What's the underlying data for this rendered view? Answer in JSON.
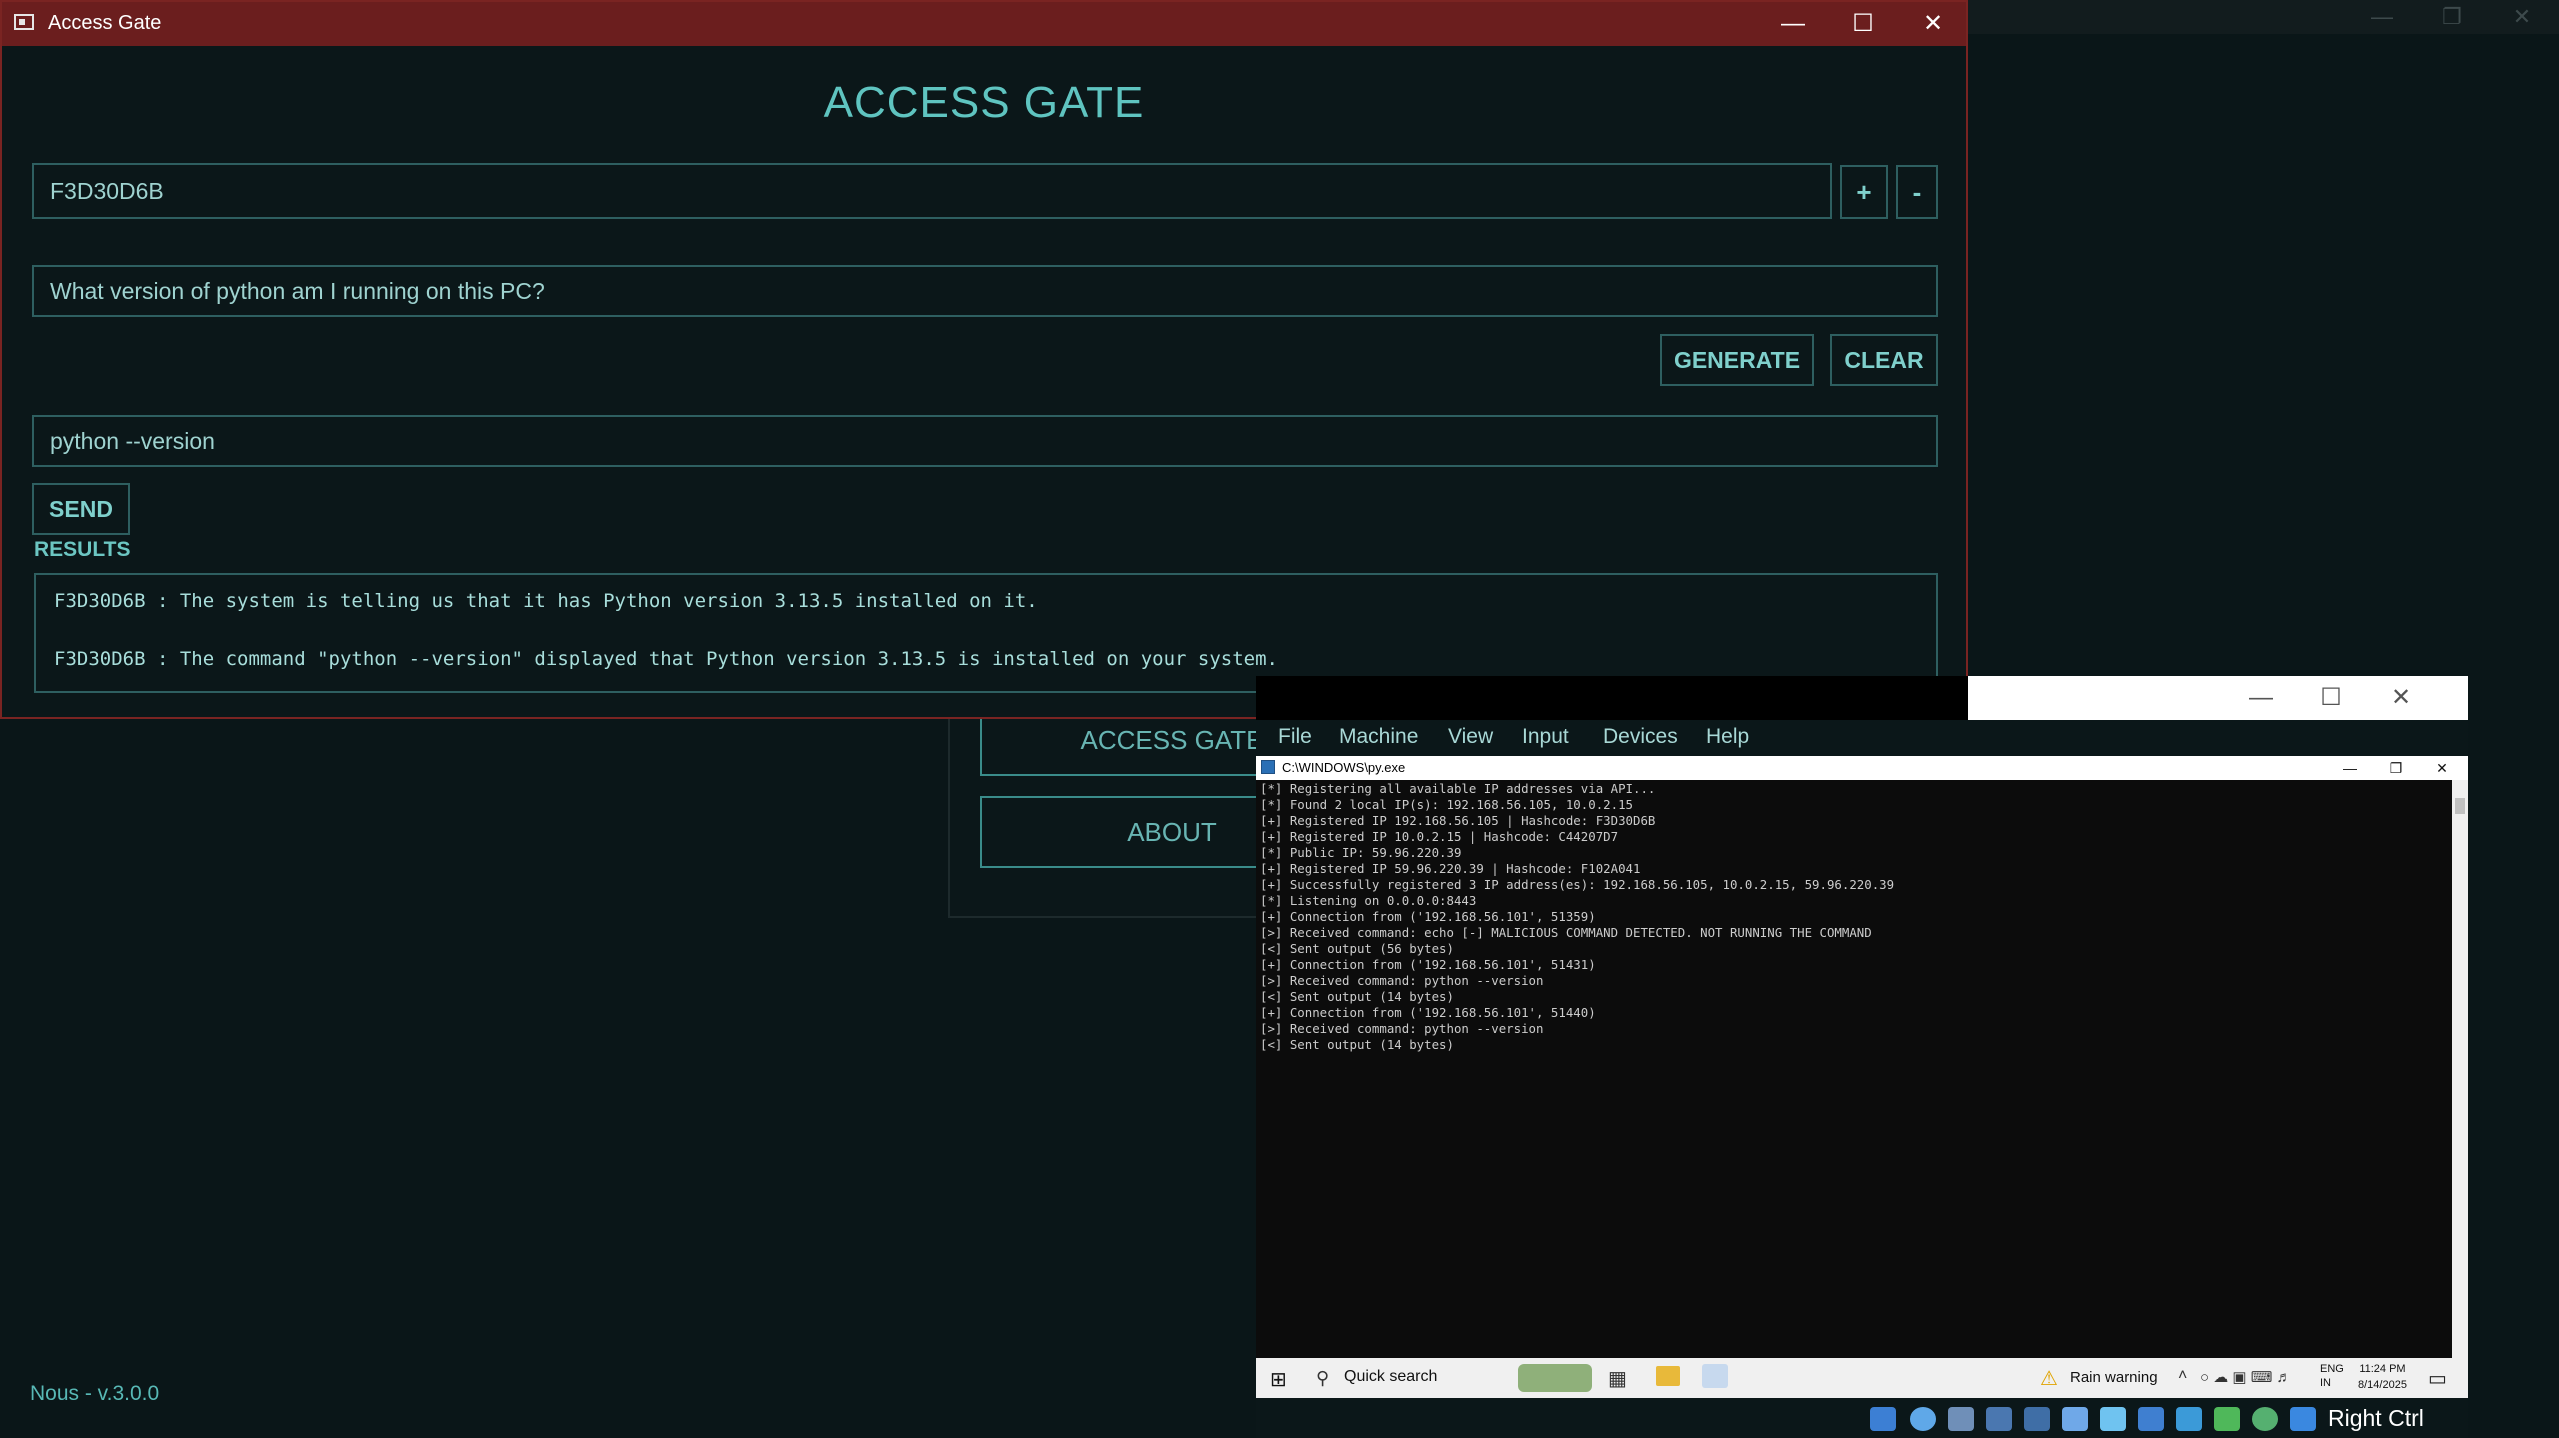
{
  "background_window": {
    "menu": {
      "access_gate_label": "ACCESS GATE",
      "about_label": "ABOUT"
    },
    "version_text": "Nous - v.3.0.0"
  },
  "gate_window": {
    "window_title": "Access Gate",
    "heading": "ACCESS GATE",
    "hashcode_value": "F3D30D6B",
    "add_label": "+",
    "remove_label": "-",
    "prompt_value": "What version of python am I running on this PC?",
    "generate_label": "GENERATE",
    "clear_label": "CLEAR",
    "command_value": "python --version",
    "send_label": "SEND",
    "results_heading": "RESULTS",
    "results": [
      "F3D30D6B : The system is telling us that it has Python version 3.13.5 installed on it.",
      "F3D30D6B : The command \"python --version\" displayed that Python version 3.13.5 is installed on your system."
    ]
  },
  "vbox": {
    "menu": [
      "File",
      "Machine",
      "View",
      "Input",
      "Devices",
      "Help"
    ],
    "console_title": "C:\\WINDOWS\\py.exe",
    "console_lines": [
      "[*] Registering all available IP addresses via API...",
      "[*] Found 2 local IP(s): 192.168.56.105, 10.0.2.15",
      "[+] Registered IP 192.168.56.105 | Hashcode: F3D30D6B",
      "[+] Registered IP 10.0.2.15 | Hashcode: C44207D7",
      "[*] Public IP: 59.96.220.39",
      "[+] Registered IP 59.96.220.39 | Hashcode: F102A041",
      "[+] Successfully registered 3 IP address(es): 192.168.56.105, 10.0.2.15, 59.96.220.39",
      "[*] Listening on 0.0.0.0:8443",
      "[+] Connection from ('192.168.56.101', 51359)",
      "[>] Received command: echo [-] MALICIOUS COMMAND DETECTED. NOT RUNNING THE COMMAND",
      "[<] Sent output (56 bytes)",
      "[+] Connection from ('192.168.56.101', 51431)",
      "[>] Received command: python --version",
      "[<] Sent output (14 bytes)",
      "[+] Connection from ('192.168.56.101', 51440)",
      "[>] Received command: python --version",
      "[<] Sent output (14 bytes)"
    ],
    "taskbar": {
      "search_placeholder": "Quick search",
      "weather": "Rain warning",
      "lang_line1": "ENG",
      "lang_line2": "IN",
      "time": "11:24 PM",
      "date": "8/14/2025"
    },
    "host_key": "Right Ctrl"
  },
  "colors": {
    "accent": "#5fc4c0",
    "gate_titlebar": "#6b1e1e",
    "background": "#0a1618"
  }
}
